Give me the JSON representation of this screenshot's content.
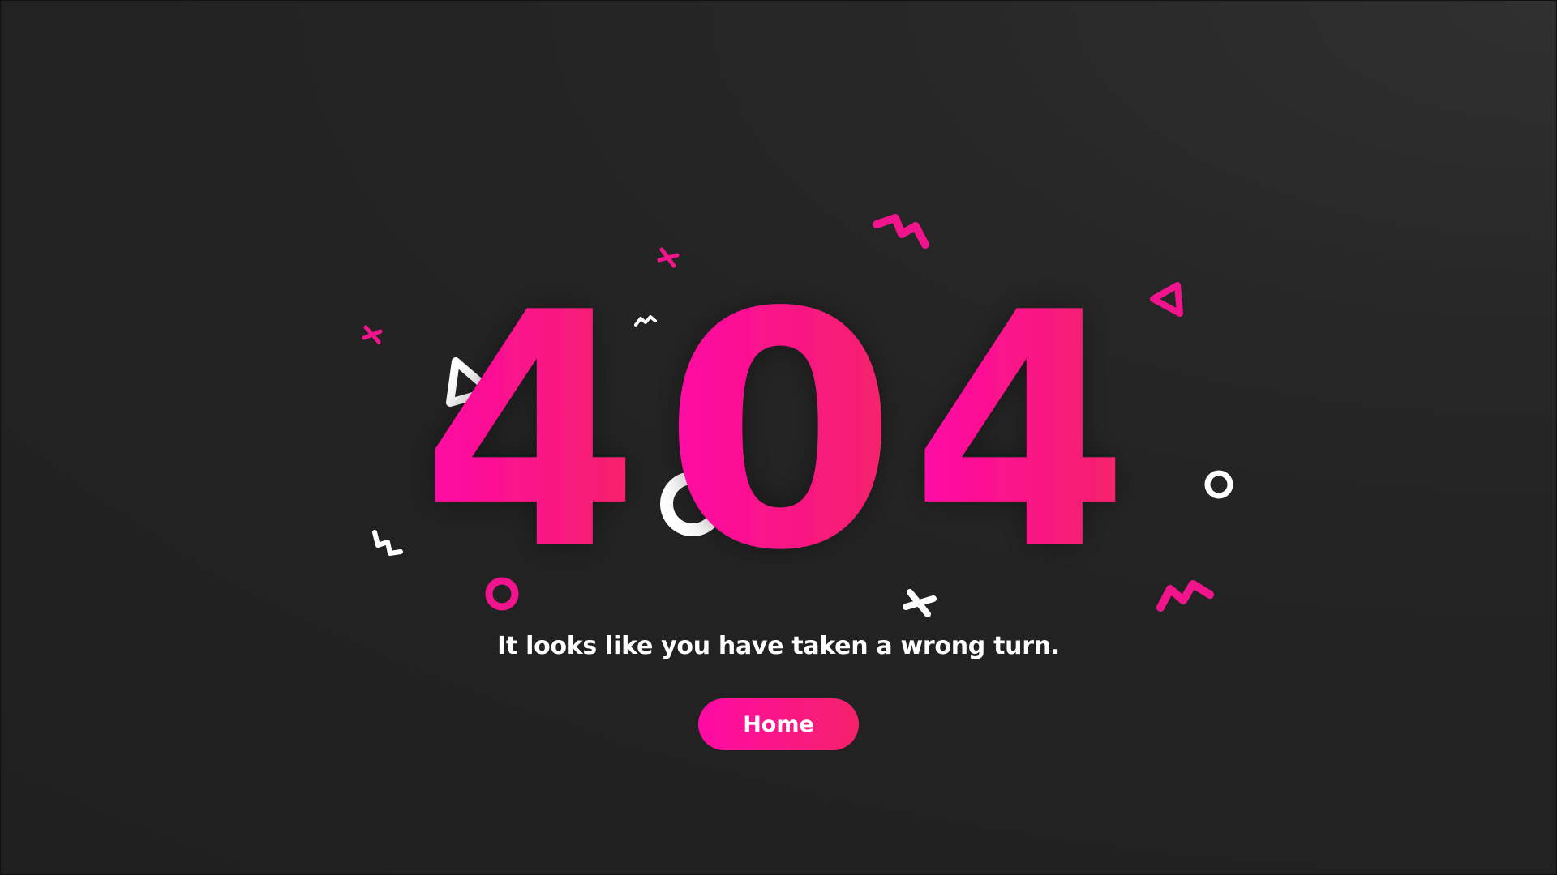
{
  "error": {
    "code_digits": [
      "4",
      "0",
      "4"
    ],
    "message": "It looks like you have taken a wrong turn.",
    "home_label": "Home"
  },
  "colors": {
    "background": "#222222",
    "gradient_start": "#ff0aa6",
    "gradient_end": "#f5226a",
    "accent_pink": "#f2148c",
    "white": "#ffffff"
  },
  "decorations": [
    "pink-zigzag-icon",
    "pink-cross-icon",
    "white-zigzag-icon",
    "pink-triangle-icon",
    "white-triangle-icon",
    "white-ring-icon",
    "pink-ring-icon",
    "white-cross-icon"
  ]
}
